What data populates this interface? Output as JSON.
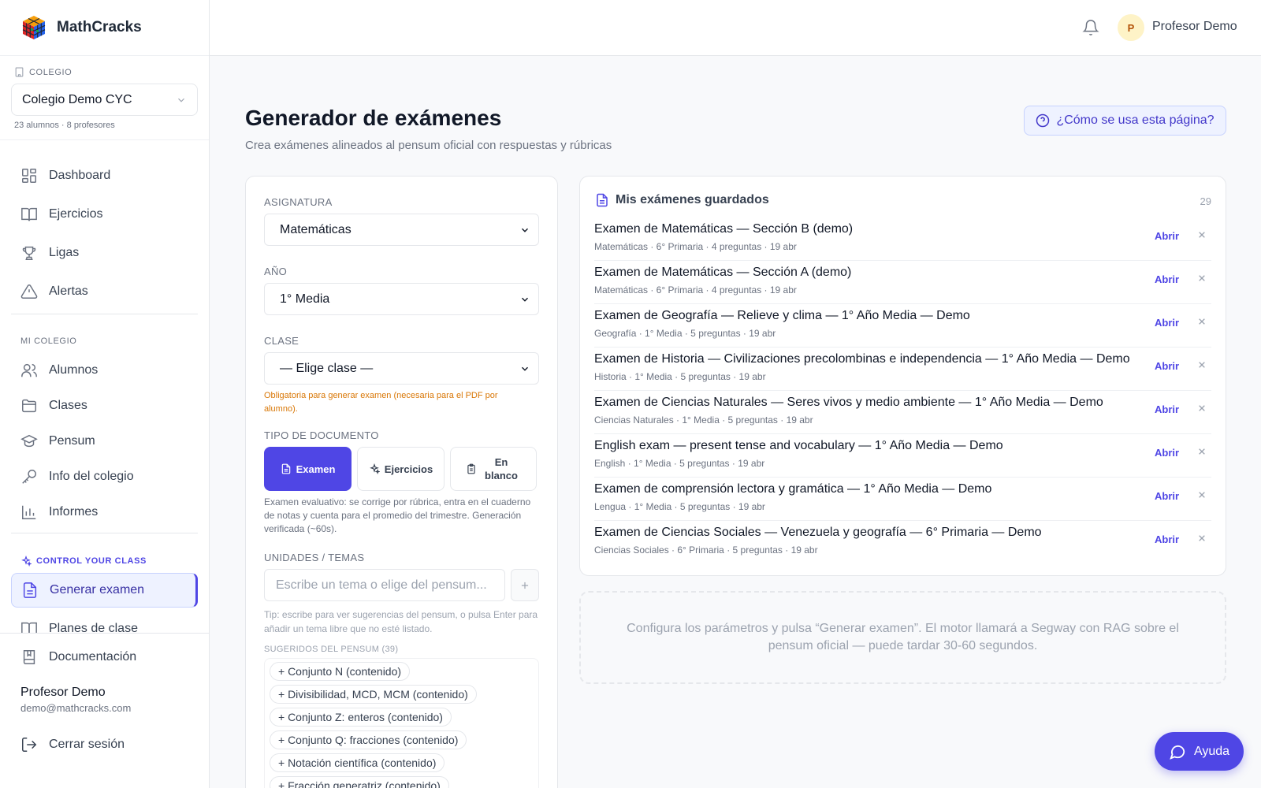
{
  "app": {
    "name": "MathCracks"
  },
  "school": {
    "label": "COLEGIO",
    "name": "Colegio Demo CYC",
    "meta": "23 alumnos · 8 profesores"
  },
  "nav": {
    "main": [
      {
        "label": "Dashboard",
        "icon": "dashboard-icon"
      },
      {
        "label": "Ejercicios",
        "icon": "book-icon"
      },
      {
        "label": "Ligas",
        "icon": "trophy-icon"
      },
      {
        "label": "Alertas",
        "icon": "alert-icon"
      }
    ],
    "mi_colegio_label": "MI COLEGIO",
    "mi_colegio": [
      {
        "label": "Alumnos",
        "icon": "users-icon"
      },
      {
        "label": "Clases",
        "icon": "folder-icon"
      },
      {
        "label": "Pensum",
        "icon": "graduation-cap-icon"
      },
      {
        "label": "Info del colegio",
        "icon": "key-icon"
      },
      {
        "label": "Informes",
        "icon": "bar-chart-icon"
      }
    ],
    "control_label": "CONTROL YOUR CLASS",
    "control": [
      {
        "label": "Generar examen",
        "icon": "file-text-icon",
        "active": true
      },
      {
        "label": "Planes de clase",
        "icon": "book-open-icon"
      }
    ],
    "documentation": "Documentación",
    "logout": "Cerrar sesión"
  },
  "user": {
    "name": "Profesor Demo",
    "email": "demo@mathcracks.com",
    "initial": "P"
  },
  "header": {
    "user_name": "Profesor Demo"
  },
  "page": {
    "title": "Generador de exámenes",
    "subtitle": "Crea exámenes alineados al pensum oficial con respuestas y rúbricas",
    "help": "¿Cómo se usa esta página?"
  },
  "form": {
    "subject_label": "ASIGNATURA",
    "subject_value": "Matemáticas",
    "year_label": "AÑO",
    "year_value": "1° Media",
    "class_label": "CLASE",
    "class_value": "— Elige clase —",
    "class_warning": "Obligatoria para generar examen (necesaria para el PDF por alumno).",
    "doc_type_label": "TIPO DE DOCUMENTO",
    "doc_types": [
      "Examen",
      "Ejercicios",
      "En blanco"
    ],
    "doc_desc": "Examen evaluativo: se corrige por rúbrica, entra en el cuaderno de notas y cuenta para el promedio del trimestre. Generación verificada (~60s).",
    "topics_label": "UNIDADES / TEMAS",
    "topics_placeholder": "Escribe un tema o elige del pensum...",
    "tip": "Tip: escribe para ver sugerencias del pensum, o pulsa Enter para añadir un tema libre que no esté listado.",
    "suggested_label": "SUGERIDOS DEL PENSUM (39)",
    "suggestions": [
      "+ Conjunto N (contenido)",
      "+ Divisibilidad, MCD, MCM (contenido)",
      "+ Conjunto Z: enteros (contenido)",
      "+ Conjunto Q: fracciones (contenido)",
      "+ Notación científica (contenido)",
      "+ Fracción generatriz (contenido)"
    ]
  },
  "saved": {
    "title": "Mis exámenes guardados",
    "count": "29",
    "open_label": "Abrir",
    "items": [
      {
        "title": "Examen de Matemáticas — Sección B (demo)",
        "meta": "Matemáticas · 6° Primaria · 4 preguntas · 19 abr"
      },
      {
        "title": "Examen de Matemáticas — Sección A (demo)",
        "meta": "Matemáticas · 6° Primaria · 4 preguntas · 19 abr"
      },
      {
        "title": "Examen de Geografía — Relieve y clima — 1° Año Media — Demo",
        "meta": "Geografía · 1° Media · 5 preguntas · 19 abr"
      },
      {
        "title": "Examen de Historia — Civilizaciones precolombinas e independencia — 1° Año Media — Demo",
        "meta": "Historia · 1° Media · 5 preguntas · 19 abr"
      },
      {
        "title": "Examen de Ciencias Naturales — Seres vivos y medio ambiente — 1° Año Media — Demo",
        "meta": "Ciencias Naturales · 1° Media · 5 preguntas · 19 abr"
      },
      {
        "title": "English exam — present tense and vocabulary — 1° Año Media — Demo",
        "meta": "English · 1° Media · 5 preguntas · 19 abr"
      },
      {
        "title": "Examen de comprensión lectora y gramática — 1° Año Media — Demo",
        "meta": "Lengua · 1° Media · 5 preguntas · 19 abr"
      },
      {
        "title": "Examen de Ciencias Sociales — Venezuela y geografía — 6° Primaria — Demo",
        "meta": "Ciencias Sociales · 6° Primaria · 5 preguntas · 19 abr"
      }
    ]
  },
  "placeholder": "Configura los parámetros y pulsa “Generar examen”. El motor llamará a Segway con RAG sobre el pensum oficial — puede tardar 30-60 segundos.",
  "ayuda": "Ayuda",
  "colors": {
    "accent": "#4f46e5",
    "warning": "#d97706"
  }
}
